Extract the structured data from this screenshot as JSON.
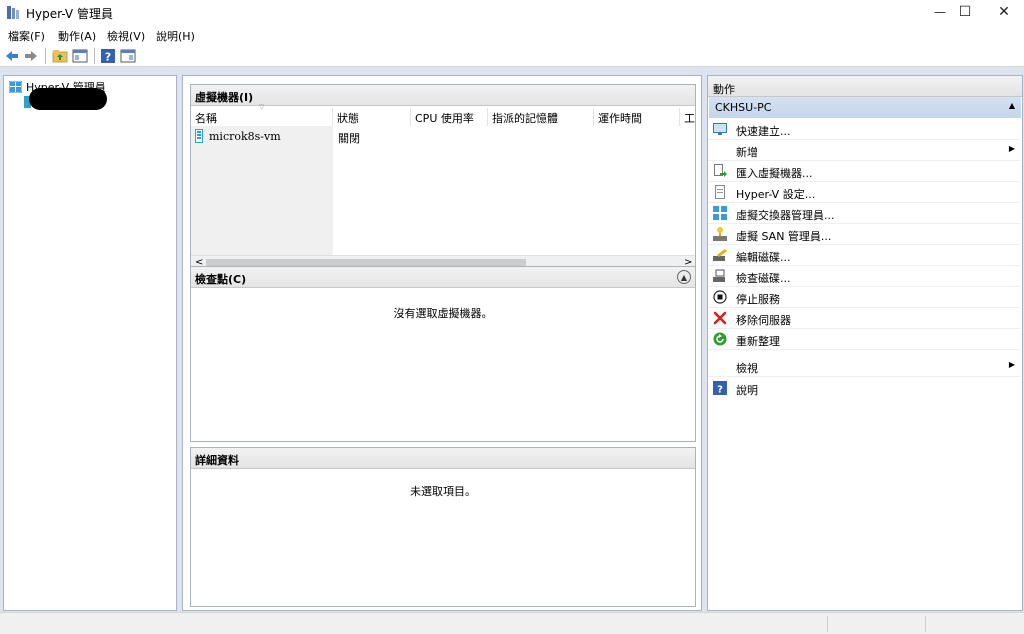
{
  "window": {
    "title": "Hyper-V 管理員",
    "minimize_glyph": "—",
    "maximize_glyph": "☐",
    "close_glyph": "✕"
  },
  "menu": [
    "檔案(F)",
    "動作(A)",
    "檢視(V)",
    "說明(H)"
  ],
  "toolbar": {
    "icons": [
      "back-arrow-icon",
      "forward-arrow-icon",
      "folder-up-icon",
      "show-hide-console-tree-icon",
      "help-icon",
      "show-hide-action-pane-icon"
    ]
  },
  "tree": {
    "root_label": "Hyper-V 管理員"
  },
  "vm_panel": {
    "title": "虛擬機器(I)",
    "columns": [
      "名稱",
      "狀態",
      "CPU 使用率",
      "指派的記憶體",
      "運作時間",
      "工"
    ],
    "rows": [
      {
        "name": "microk8s-vm",
        "state": "關閉"
      }
    ],
    "scroll_left": "<",
    "scroll_right": ">"
  },
  "checkpoint_panel": {
    "title": "檢查點(C)",
    "message": "沒有選取虛擬機器。"
  },
  "details_panel": {
    "title": "詳細資料",
    "message": "未選取項目。"
  },
  "actions": {
    "title": "動作",
    "host": "CKHSU-PC",
    "items": [
      {
        "label": "快速建立...",
        "icon": "quick-create-icon",
        "submenu": false
      },
      {
        "label": "新增",
        "icon": "",
        "submenu": true
      },
      {
        "label": "匯入虛擬機器...",
        "icon": "import-vm-icon",
        "submenu": false
      },
      {
        "label": "Hyper-V 設定...",
        "icon": "hyperv-settings-icon",
        "submenu": false
      },
      {
        "label": "虛擬交換器管理員...",
        "icon": "virtual-switch-manager-icon",
        "submenu": false
      },
      {
        "label": "虛擬 SAN 管理員...",
        "icon": "virtual-san-manager-icon",
        "submenu": false
      },
      {
        "label": "編輯磁碟...",
        "icon": "edit-disk-icon",
        "submenu": false
      },
      {
        "label": "檢查磁碟...",
        "icon": "inspect-disk-icon",
        "submenu": false
      },
      {
        "label": "停止服務",
        "icon": "stop-service-icon",
        "submenu": false
      },
      {
        "label": "移除伺服器",
        "icon": "remove-server-icon",
        "submenu": false
      },
      {
        "label": "重新整理",
        "icon": "refresh-icon",
        "submenu": false
      },
      {
        "label": "檢視",
        "icon": "",
        "submenu": true
      },
      {
        "label": "說明",
        "icon": "help-icon",
        "submenu": false
      }
    ]
  },
  "colors": {
    "accent_blue": "#3a72c4",
    "actions_header": "#c9d8ee",
    "main_background": "#dde4ef",
    "remove_red": "#d42020",
    "refresh_green": "#2e9b2e"
  }
}
